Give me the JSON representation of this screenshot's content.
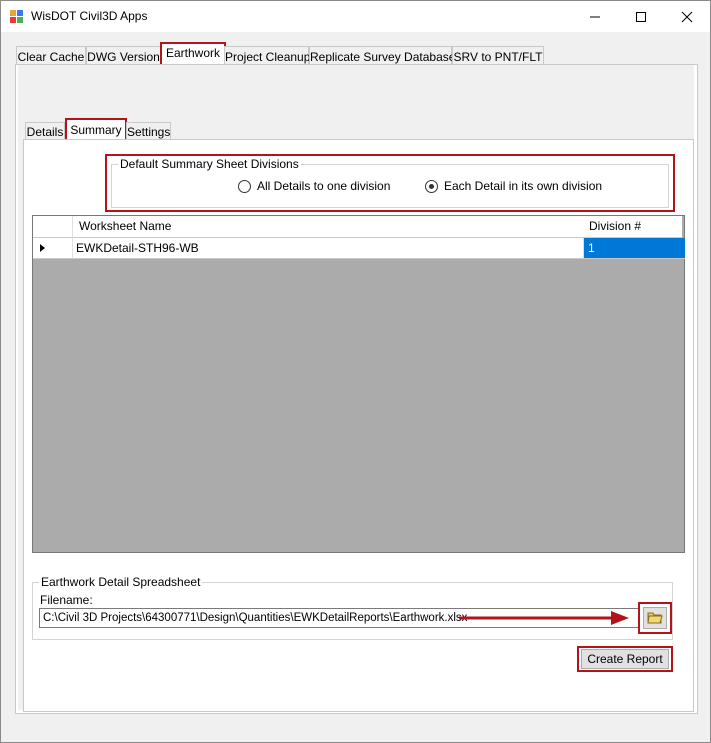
{
  "window": {
    "title": "WisDOT Civil3D Apps",
    "icons": [
      "app-icon",
      "minimize-icon",
      "maximize-icon",
      "close-icon"
    ]
  },
  "main_tabs": [
    {
      "label": "Clear Cache"
    },
    {
      "label": "DWG Version"
    },
    {
      "label": "Earthwork"
    },
    {
      "label": "Project Cleanup"
    },
    {
      "label": "Replicate Survey Database"
    },
    {
      "label": "SRV to PNT/FLT"
    }
  ],
  "sub_tabs": [
    {
      "label": "Details"
    },
    {
      "label": "Summary"
    },
    {
      "label": "Settings"
    }
  ],
  "divisions": {
    "legend": "Default Summary Sheet Divisions",
    "option_all": "All Details to one division",
    "option_each": "Each Detail in its own division",
    "selected": "each"
  },
  "grid": {
    "columns": [
      "Worksheet Name",
      "Division #"
    ],
    "rows": [
      {
        "worksheet": "EWKDetail-STH96-WB",
        "division": "1"
      }
    ]
  },
  "spreadsheet": {
    "legend": "Earthwork Detail Spreadsheet",
    "filename_label": "Filename:",
    "filename_value": "C:\\Civil 3D Projects\\64300771\\Design\\Quantities\\EWKDetailReports\\Earthwork.xlsx"
  },
  "buttons": {
    "create_report": "Create Report"
  },
  "colors": {
    "highlight": "#b3141a",
    "selection": "#0078d7",
    "grid_bg": "#ababab"
  }
}
